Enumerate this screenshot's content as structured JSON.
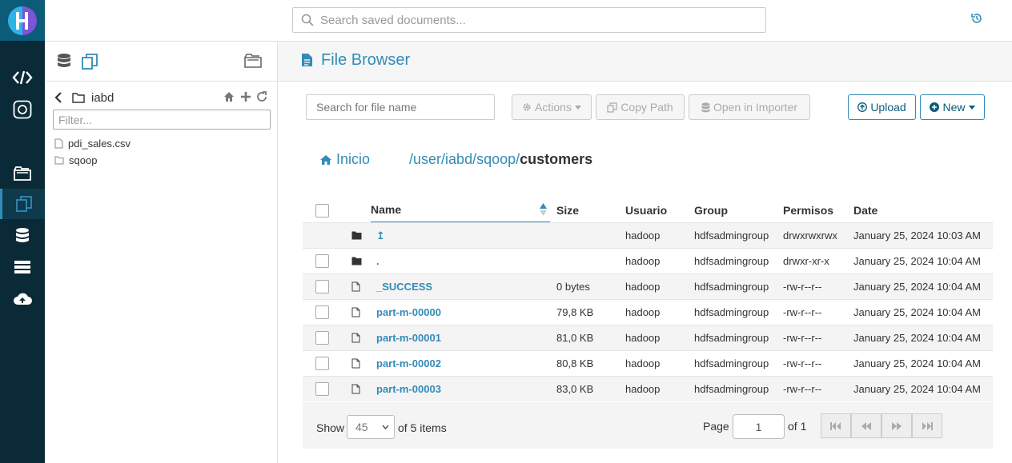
{
  "topbar": {
    "search_placeholder": "Search saved documents..."
  },
  "assist": {
    "folder_name": "iabd",
    "filter_placeholder": "Filter...",
    "entries": [
      {
        "name": "pdi_sales.csv",
        "type": "file"
      },
      {
        "name": "sqoop",
        "type": "folder"
      }
    ]
  },
  "page": {
    "title": "File Browser"
  },
  "toolbar": {
    "search_placeholder": "Search for file name",
    "actions_label": "Actions",
    "copy_path_label": "Copy Path",
    "open_importer_label": "Open in Importer",
    "upload_label": "Upload",
    "new_label": "New"
  },
  "breadcrumb": {
    "home_label": "Inicio",
    "segments": [
      "user",
      "iabd",
      "sqoop"
    ],
    "current": "customers"
  },
  "table": {
    "headers": {
      "name": "Name",
      "size": "Size",
      "user": "Usuario",
      "group": "Group",
      "perms": "Permisos",
      "date": "Date"
    },
    "rows": [
      {
        "name": "↥",
        "type": "folder",
        "size": "",
        "user": "hadoop",
        "group": "hdfsadmingroup",
        "perms": "drwxrwxrwx",
        "date": "January 25, 2024 10:03 AM"
      },
      {
        "name": ".",
        "type": "folder",
        "size": "",
        "user": "hadoop",
        "group": "hdfsadmingroup",
        "perms": "drwxr-xr-x",
        "date": "January 25, 2024 10:04 AM"
      },
      {
        "name": "_SUCCESS",
        "type": "file",
        "size": "0 bytes",
        "user": "hadoop",
        "group": "hdfsadmingroup",
        "perms": "-rw-r--r--",
        "date": "January 25, 2024 10:04 AM"
      },
      {
        "name": "part-m-00000",
        "type": "file",
        "size": "79,8 KB",
        "user": "hadoop",
        "group": "hdfsadmingroup",
        "perms": "-rw-r--r--",
        "date": "January 25, 2024 10:04 AM"
      },
      {
        "name": "part-m-00001",
        "type": "file",
        "size": "81,0 KB",
        "user": "hadoop",
        "group": "hdfsadmingroup",
        "perms": "-rw-r--r--",
        "date": "January 25, 2024 10:04 AM"
      },
      {
        "name": "part-m-00002",
        "type": "file",
        "size": "80,8 KB",
        "user": "hadoop",
        "group": "hdfsadmingroup",
        "perms": "-rw-r--r--",
        "date": "January 25, 2024 10:04 AM"
      },
      {
        "name": "part-m-00003",
        "type": "file",
        "size": "83,0 KB",
        "user": "hadoop",
        "group": "hdfsadmingroup",
        "perms": "-rw-r--r--",
        "date": "January 25, 2024 10:04 AM"
      }
    ]
  },
  "footer": {
    "show_label": "Show",
    "page_size": "45",
    "of_items": "of 5 items",
    "page_label": "Page",
    "page_value": "1",
    "page_of": "of 1"
  },
  "colors": {
    "accent": "#338bb8",
    "rail": "#0b2a37",
    "logo_bg": "#0b5b79"
  }
}
